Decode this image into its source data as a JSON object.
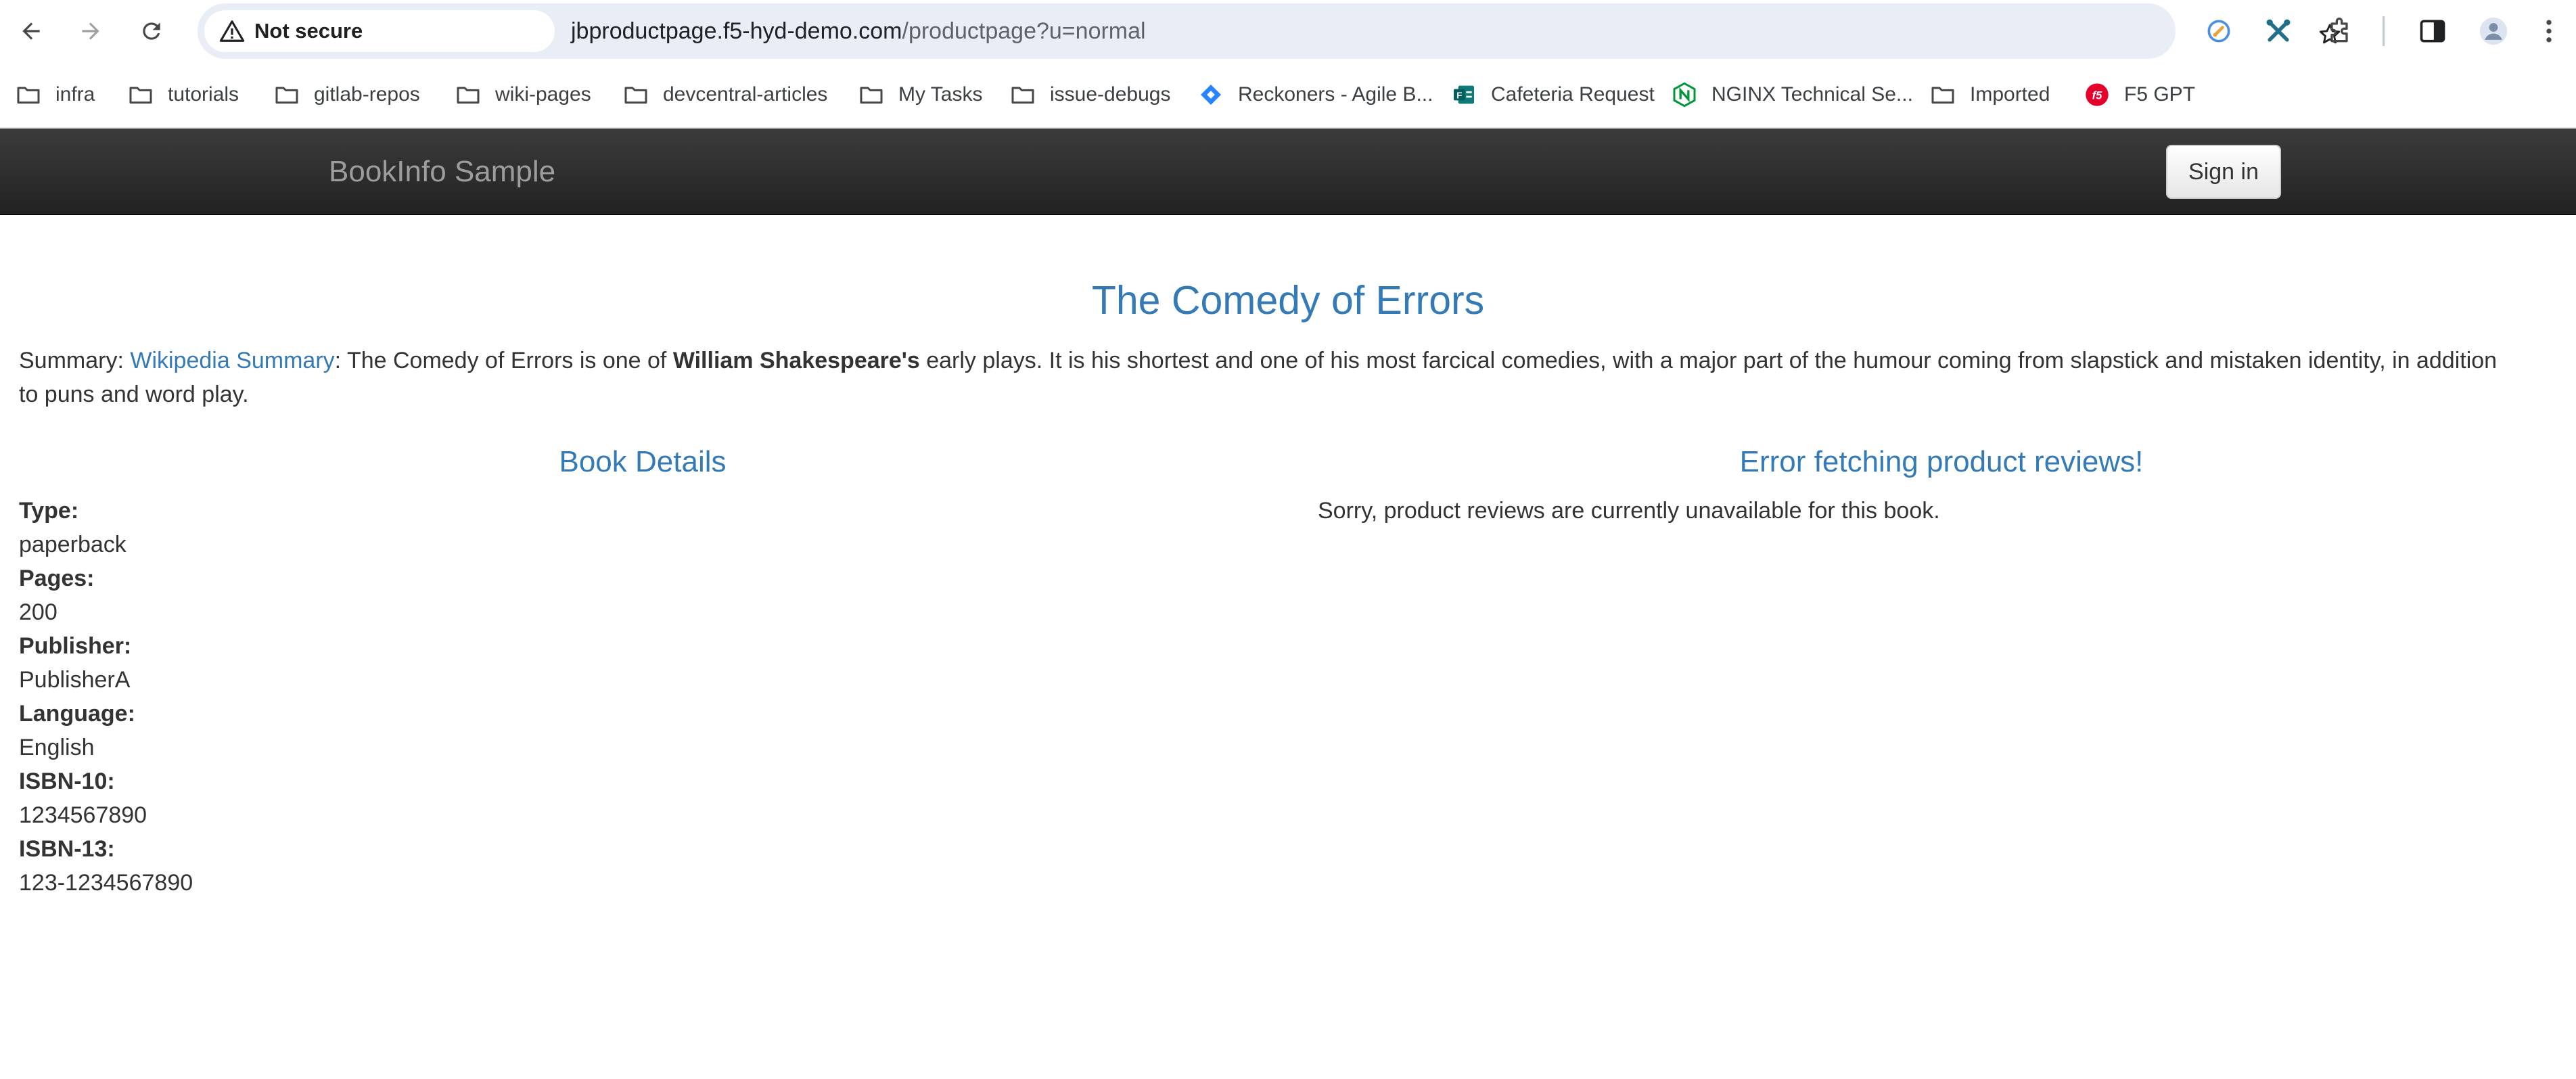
{
  "browser": {
    "security_label": "Not secure",
    "url_host": "jbproductpage.f5-hyd-demo.com",
    "url_path": "/productpage?u=normal",
    "icons": [
      "back-icon",
      "forward-icon",
      "reload-icon",
      "warning-icon",
      "star-icon",
      "extension-icon",
      "puzzle-icon",
      "side-panel-icon",
      "profile-avatar",
      "more-icon"
    ]
  },
  "bookmarks": [
    {
      "label": "infra",
      "icon": "folder-icon"
    },
    {
      "label": "tutorials",
      "icon": "folder-icon"
    },
    {
      "label": "gitlab-repos",
      "icon": "folder-icon"
    },
    {
      "label": "wiki-pages",
      "icon": "folder-icon"
    },
    {
      "label": "devcentral-articles",
      "icon": "folder-icon"
    },
    {
      "label": "My Tasks",
      "icon": "folder-icon"
    },
    {
      "label": "issue-debugs",
      "icon": "folder-icon"
    },
    {
      "label": "Reckoners - Agile B...",
      "icon": "jira-icon"
    },
    {
      "label": "Cafeteria Request",
      "icon": "forms-icon"
    },
    {
      "label": "NGINX Technical Se...",
      "icon": "nginx-icon"
    },
    {
      "label": "Imported",
      "icon": "folder-icon"
    },
    {
      "label": "F5 GPT",
      "icon": "f5-icon"
    }
  ],
  "navbar": {
    "brand": "BookInfo Sample",
    "signin_label": "Sign in"
  },
  "product": {
    "title": "The Comedy of Errors",
    "summary_prefix": "Summary: ",
    "summary_link": "Wikipedia Summary",
    "summary_text_1": ": The Comedy of Errors is one of ",
    "summary_bold": "William Shakespeare's",
    "summary_text_2": " early plays. It is his shortest and one of his most farcical comedies, with a major part of the humour coming from slapstick and mistaken identity, in addition to puns and word play."
  },
  "details": {
    "heading": "Book Details",
    "fields": [
      {
        "label": "Type:",
        "value": "paperback"
      },
      {
        "label": "Pages:",
        "value": "200"
      },
      {
        "label": "Publisher:",
        "value": "PublisherA"
      },
      {
        "label": "Language:",
        "value": "English"
      },
      {
        "label": "ISBN-10:",
        "value": "1234567890"
      },
      {
        "label": "ISBN-13:",
        "value": "123-1234567890"
      }
    ]
  },
  "reviews": {
    "heading": "Error fetching product reviews!",
    "message": "Sorry, product reviews are currently unavailable for this book."
  }
}
